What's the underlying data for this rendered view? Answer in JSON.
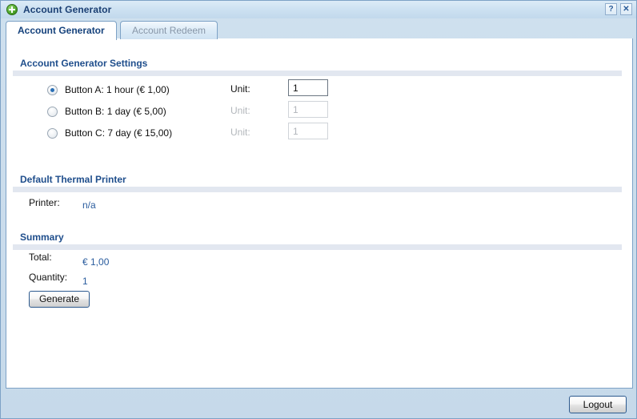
{
  "window": {
    "title": "Account Generator",
    "icon": "green-plus-circle-icon",
    "help_button": "?",
    "close_button": "✕",
    "frame_color": "#7da2c6",
    "titlebar_text_color": "#1b3f73"
  },
  "tabs": [
    {
      "label": "Account Generator",
      "active": true
    },
    {
      "label": "Account Redeem",
      "active": false
    }
  ],
  "sections": {
    "settings": {
      "heading": "Account Generator Settings",
      "options": [
        {
          "label": "Button A: 1 hour (€ 1,00)",
          "selected": true,
          "unit_label": "Unit:",
          "unit_value": "1",
          "enabled": true
        },
        {
          "label": "Button B: 1 day (€ 5,00)",
          "selected": false,
          "unit_label": "Unit:",
          "unit_value": "1",
          "enabled": false
        },
        {
          "label": "Button C: 7 day (€ 15,00)",
          "selected": false,
          "unit_label": "Unit:",
          "unit_value": "1",
          "enabled": false
        }
      ]
    },
    "printer": {
      "heading": "Default Thermal Printer",
      "label": "Printer:",
      "value": "n/a"
    },
    "summary": {
      "heading": "Summary",
      "total_label": "Total:",
      "total_value": "€ 1,00",
      "quantity_label": "Quantity:",
      "quantity_value": "1",
      "generate_label": "Generate"
    }
  },
  "footer": {
    "logout_label": "Logout"
  },
  "colors": {
    "heading": "#1f4e8c",
    "value": "#2a5c9e",
    "divider": "#e2e7f0",
    "radio_dot": "#2a6fb5",
    "disabled_text": "#b2b6bb"
  }
}
